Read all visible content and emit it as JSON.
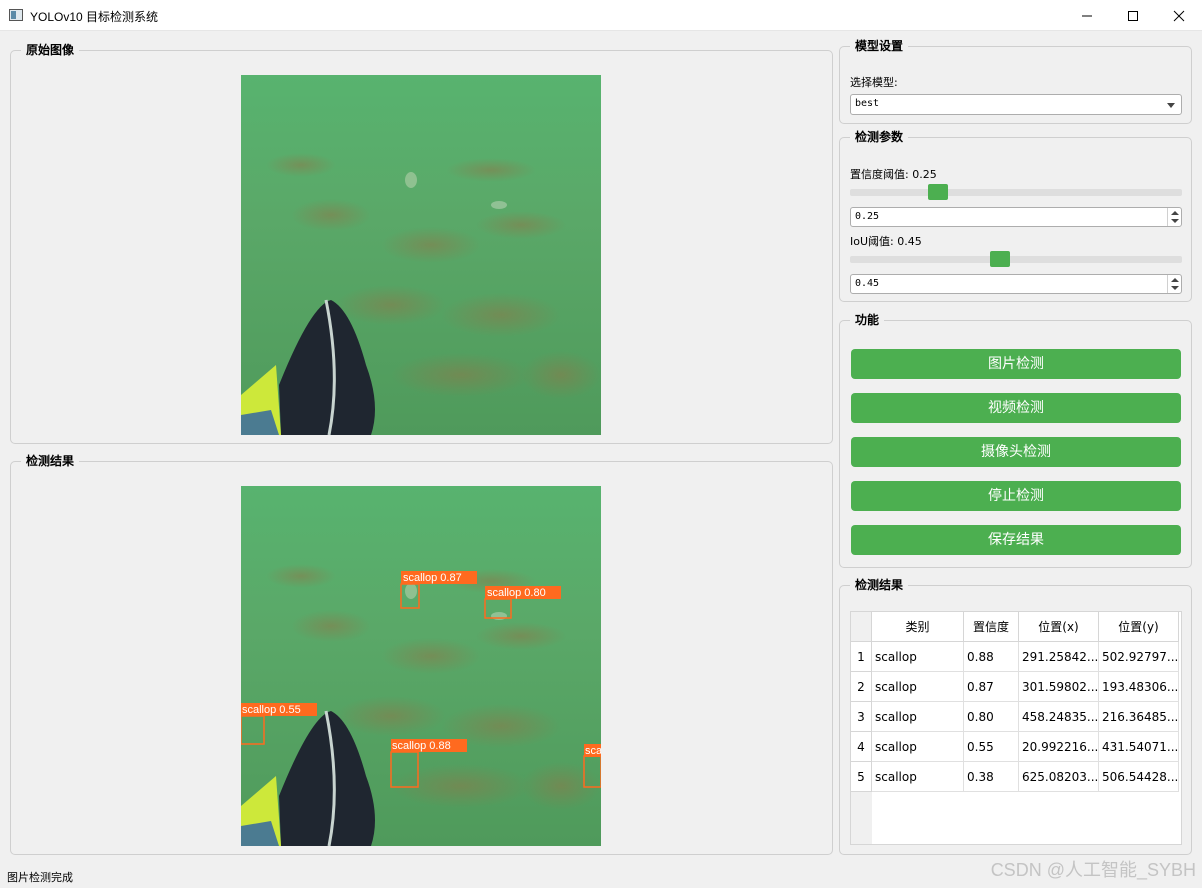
{
  "window": {
    "title": "YOLOv10 目标检测系统"
  },
  "left": {
    "original": {
      "title": "原始图像"
    },
    "result": {
      "title": "检测结果",
      "detections": [
        {
          "label": "scallop 0.87"
        },
        {
          "label": "scallop 0.80"
        },
        {
          "label": "scallop 0.55"
        },
        {
          "label": "scallop 0.88"
        },
        {
          "label": "sca"
        }
      ]
    }
  },
  "model": {
    "title": "模型设置",
    "select_label": "选择模型:",
    "selected": "best"
  },
  "params": {
    "title": "检测参数",
    "conf_label": "置信度阈值: 0.25",
    "conf_value": "0.25",
    "conf_fraction": 0.25,
    "iou_label": "IoU阈值: 0.45",
    "iou_value": "0.45",
    "iou_fraction": 0.45
  },
  "functions": {
    "title": "功能",
    "buttons": [
      "图片检测",
      "视频检测",
      "摄像头检测",
      "停止检测",
      "保存结果"
    ]
  },
  "results": {
    "title": "检测结果",
    "columns": [
      "类别",
      "置信度",
      "位置(x)",
      "位置(y)"
    ],
    "rows": [
      {
        "num": "1",
        "cls": "scallop",
        "conf": "0.88",
        "x": "291.25842...",
        "y": "502.92797..."
      },
      {
        "num": "2",
        "cls": "scallop",
        "conf": "0.87",
        "x": "301.59802...",
        "y": "193.48306..."
      },
      {
        "num": "3",
        "cls": "scallop",
        "conf": "0.80",
        "x": "458.24835...",
        "y": "216.36485..."
      },
      {
        "num": "4",
        "cls": "scallop",
        "conf": "0.55",
        "x": "20.992216...",
        "y": "431.54071..."
      },
      {
        "num": "5",
        "cls": "scallop",
        "conf": "0.38",
        "x": "625.08203...",
        "y": "506.54428..."
      }
    ]
  },
  "status": {
    "text": "图片检测完成"
  },
  "watermark": "CSDN @人工智能_SYBH",
  "colors": {
    "accent": "#4caf50",
    "detection": "#ff6a1f"
  }
}
